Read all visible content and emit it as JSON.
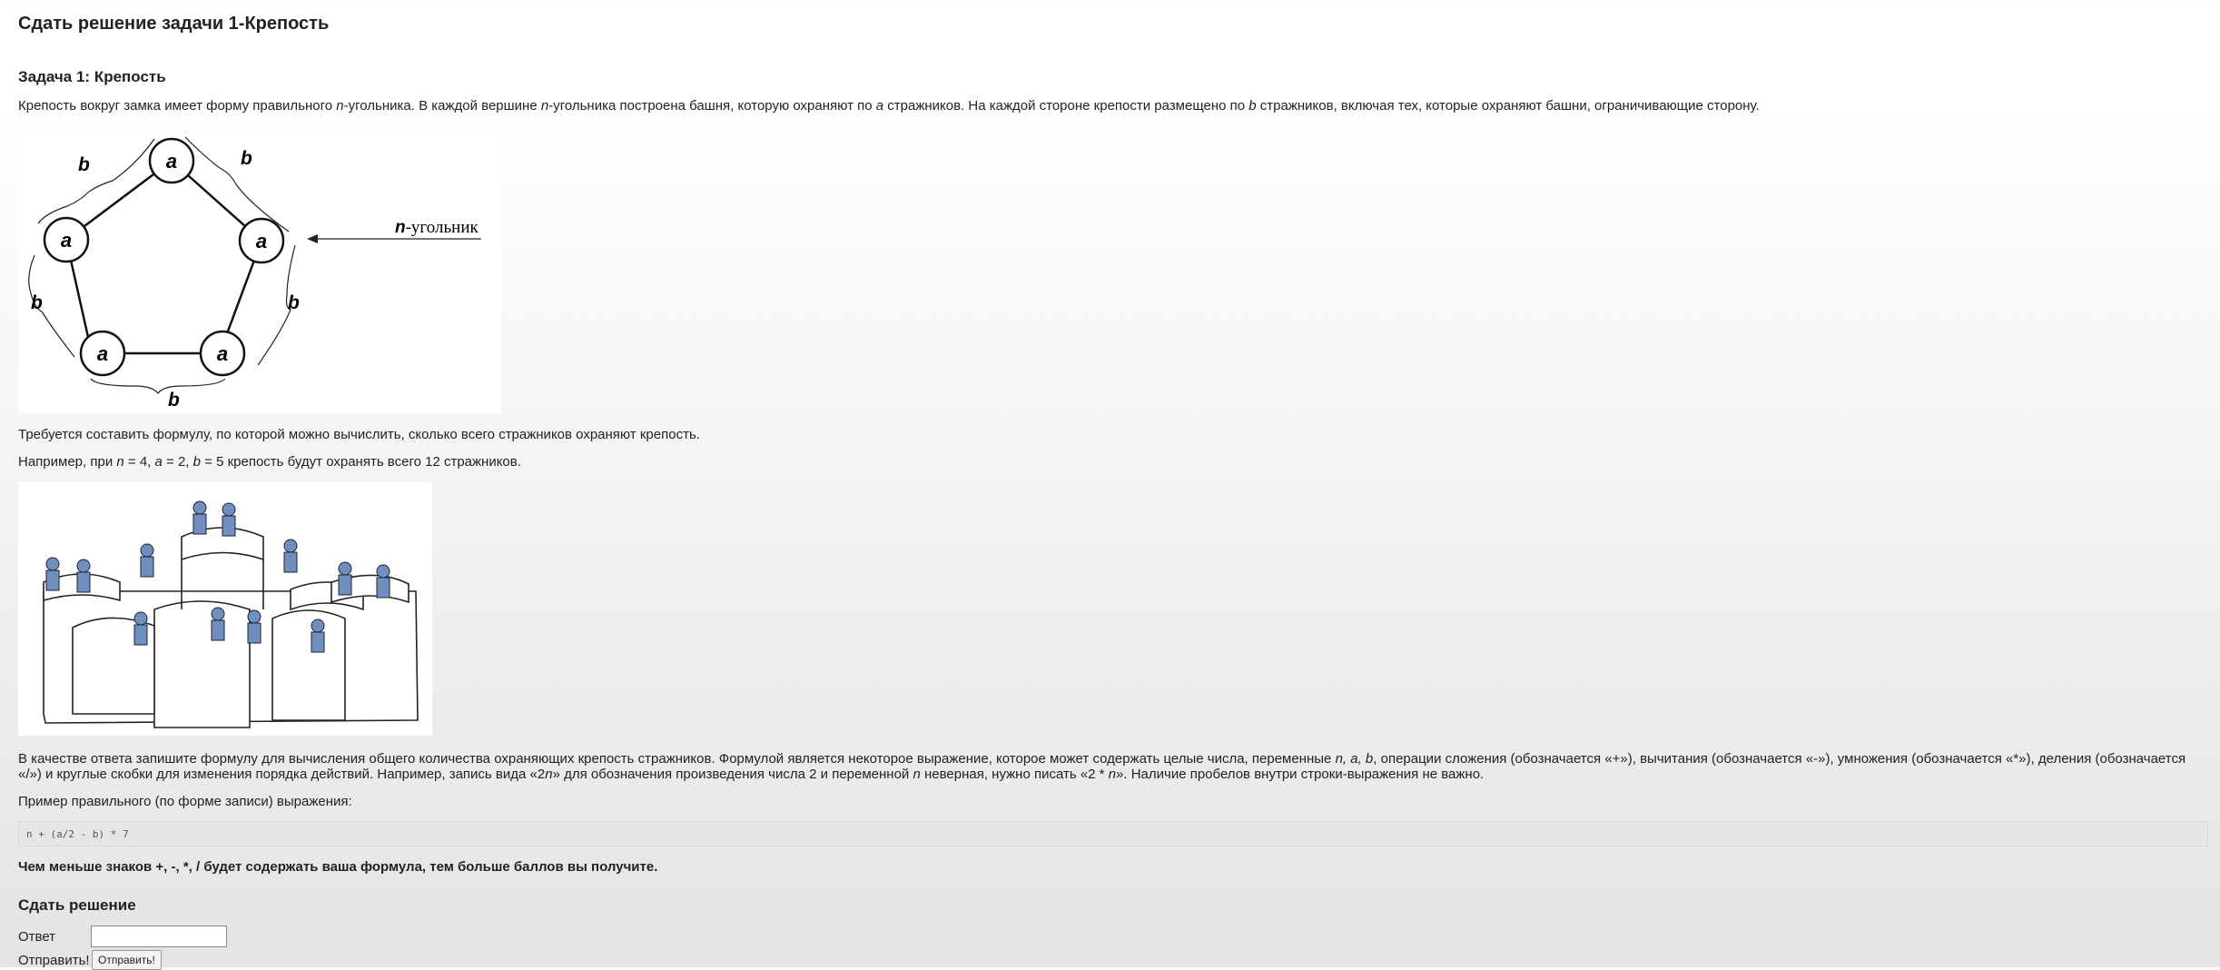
{
  "page": {
    "title": "Сдать решение задачи 1-Крепость"
  },
  "task": {
    "title": "Задача 1: Крепость",
    "intro": {
      "t1": "Крепость вокруг замка имеет форму правильного ",
      "v1": "n",
      "t2": "-угольника. В каждой вершине ",
      "v2": "n",
      "t3": "-угольника построена башня, которую охраняют по ",
      "v3": "a",
      "t4": " стражников. На каждой стороне крепости размещено по ",
      "v4": "b",
      "t5": " стражников, включая тех, которые охраняют башни, ограничивающие сторону."
    },
    "diagram": {
      "tower_label": "a",
      "side_label": "b",
      "pointer_label_var": "n",
      "pointer_label_text": "-угольник"
    },
    "requirement": "Требуется составить формулу, по которой можно вычислить, сколько всего стражников охраняют крепость.",
    "example": {
      "t1": "Например, при ",
      "v1": "n",
      "t2": " = 4, ",
      "v2": "a",
      "t3": " = 2, ",
      "v3": "b",
      "t4": " = 5 крепость будут охранять всего 12 стражников."
    },
    "instructions": {
      "line1": {
        "t1": "В качестве ответа запишите формулу для вычисления общего количества охраняющих крепость стражников. Формулой является некоторое выражение, которое может содержать целые числа, переменные ",
        "v1": "n, a, b",
        "t2": ", операции сложения (обозначается «+»), вычитания (обозначается «-»), умножения (обозначается «*»), деления (обозначается"
      },
      "line2": {
        "t1": "«/») и круглые скобки для изменения порядка действий. Например, запись вида «2",
        "v1": "n",
        "t2": "» для обозначения произведения числа 2 и переменной ",
        "v2": "n",
        "t3": " неверная, нужно писать «2 * ",
        "v3": "n",
        "t4": "». Наличие пробелов внутри строки-выражения не важно."
      }
    },
    "sample_label": "Пример правильного (по форме записи) выражения:",
    "sample_code": "n + (a/2 - b) * 7",
    "note": "Чем меньше знаков +, -, *, / будет содержать ваша формула, тем больше баллов вы получите."
  },
  "submit": {
    "heading": "Сдать решение",
    "answer_label": "Ответ",
    "answer_value": "",
    "send_label": "Отправить!",
    "send_button": "Отправить!"
  }
}
